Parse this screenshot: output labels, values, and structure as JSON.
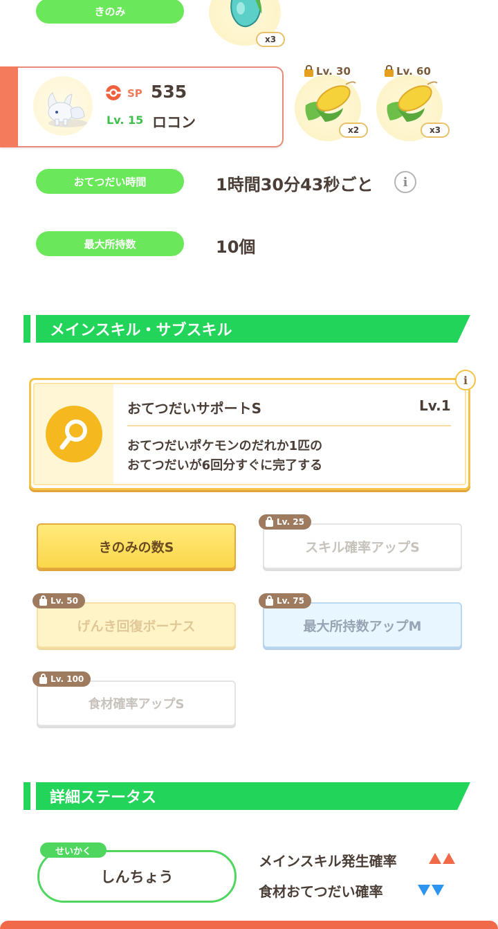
{
  "berry": {
    "label": "きのみ",
    "count": "x3",
    "icon": "berry-icon"
  },
  "pokemon": {
    "sp_label": "SP",
    "sp_value": "535",
    "level": "Lv. 15",
    "name": "ロコン",
    "icon": "alolan-vulpix-icon"
  },
  "ingredients": [
    {
      "lock_level": "Lv. 30",
      "count": "x2",
      "icon": "corn-icon"
    },
    {
      "lock_level": "Lv. 60",
      "count": "x3",
      "icon": "corn-icon"
    }
  ],
  "help_time": {
    "label": "おてつだい時間",
    "value": "1時間30分43秒ごと"
  },
  "max_carry": {
    "label": "最大所持数",
    "value": "10個"
  },
  "skills_section": {
    "title": "メインスキル・サブスキル"
  },
  "main_skill": {
    "name": "おてつだいサポートS",
    "level": "Lv.1",
    "description_line1": "おてつだいポケモンのだれか1匹の",
    "description_line2": "おてつだいが6回分すぐに完了する",
    "icon": "magnifier-icon"
  },
  "sub_skills": [
    {
      "label": "きのみの数S",
      "lock": ""
    },
    {
      "label": "スキル確率アップS",
      "lock": "Lv. 25"
    },
    {
      "label": "げんき回復ボーナス",
      "lock": "Lv. 50"
    },
    {
      "label": "最大所持数アップM",
      "lock": "Lv. 75"
    },
    {
      "label": "食材確率アップS",
      "lock": "Lv. 100"
    }
  ],
  "detail_section": {
    "title": "詳細ステータス"
  },
  "nature": {
    "tag": "せいかく",
    "value": "しんちょう",
    "stat_up": "メインスキル発生確率",
    "stat_down": "食材おてつだい確率"
  },
  "colors": {
    "green": "#23d45a",
    "pill_green": "#6ae85a",
    "gold": "#f6c247",
    "up": "#f06a4a",
    "down": "#2c95ef"
  }
}
